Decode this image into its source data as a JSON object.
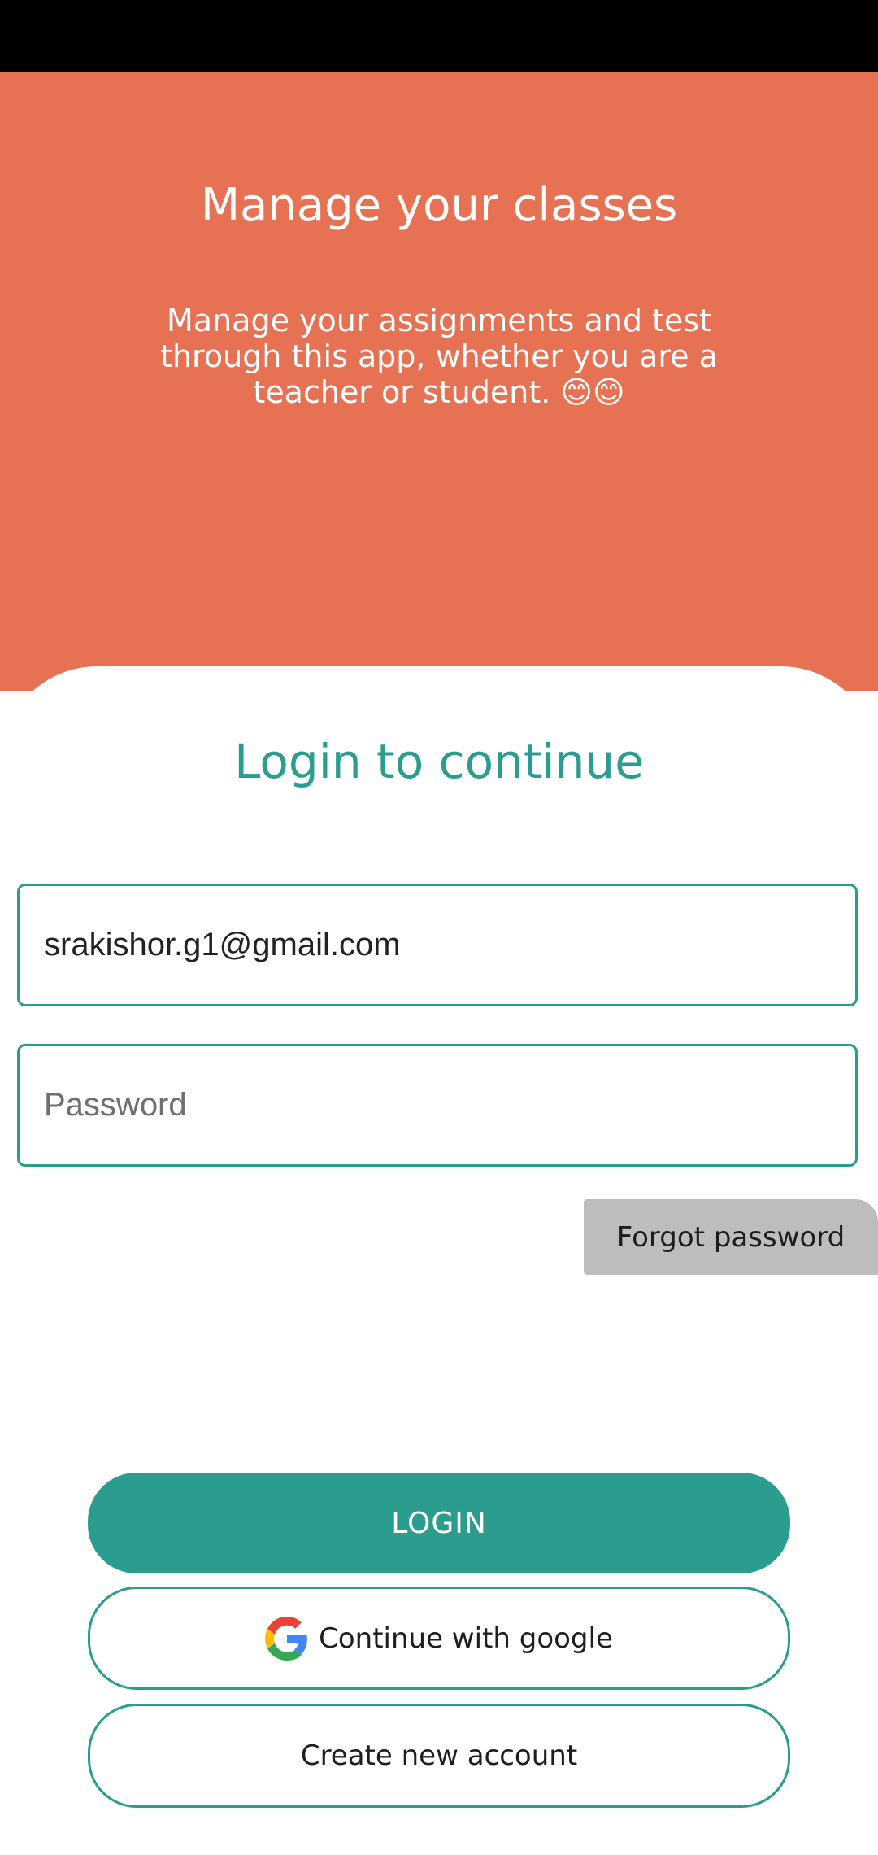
{
  "hero": {
    "title": "Manage your classes",
    "subtitle": "Manage your assignments and test through this app, whether you are a teacher or student. 😊😊"
  },
  "login": {
    "title": "Login to continue",
    "email_value": "srakishor.g1@gmail.com",
    "password_placeholder": "Password",
    "forgot_label": "Forgot password",
    "login_label": "LOGIN",
    "google_label": "Continue with google",
    "create_label": "Create new account"
  },
  "colors": {
    "hero_bg": "#E77153",
    "accent": "#2A9D8F",
    "forgot_bg": "#BDBDBD"
  },
  "icons": {
    "google": "google-g-icon"
  }
}
